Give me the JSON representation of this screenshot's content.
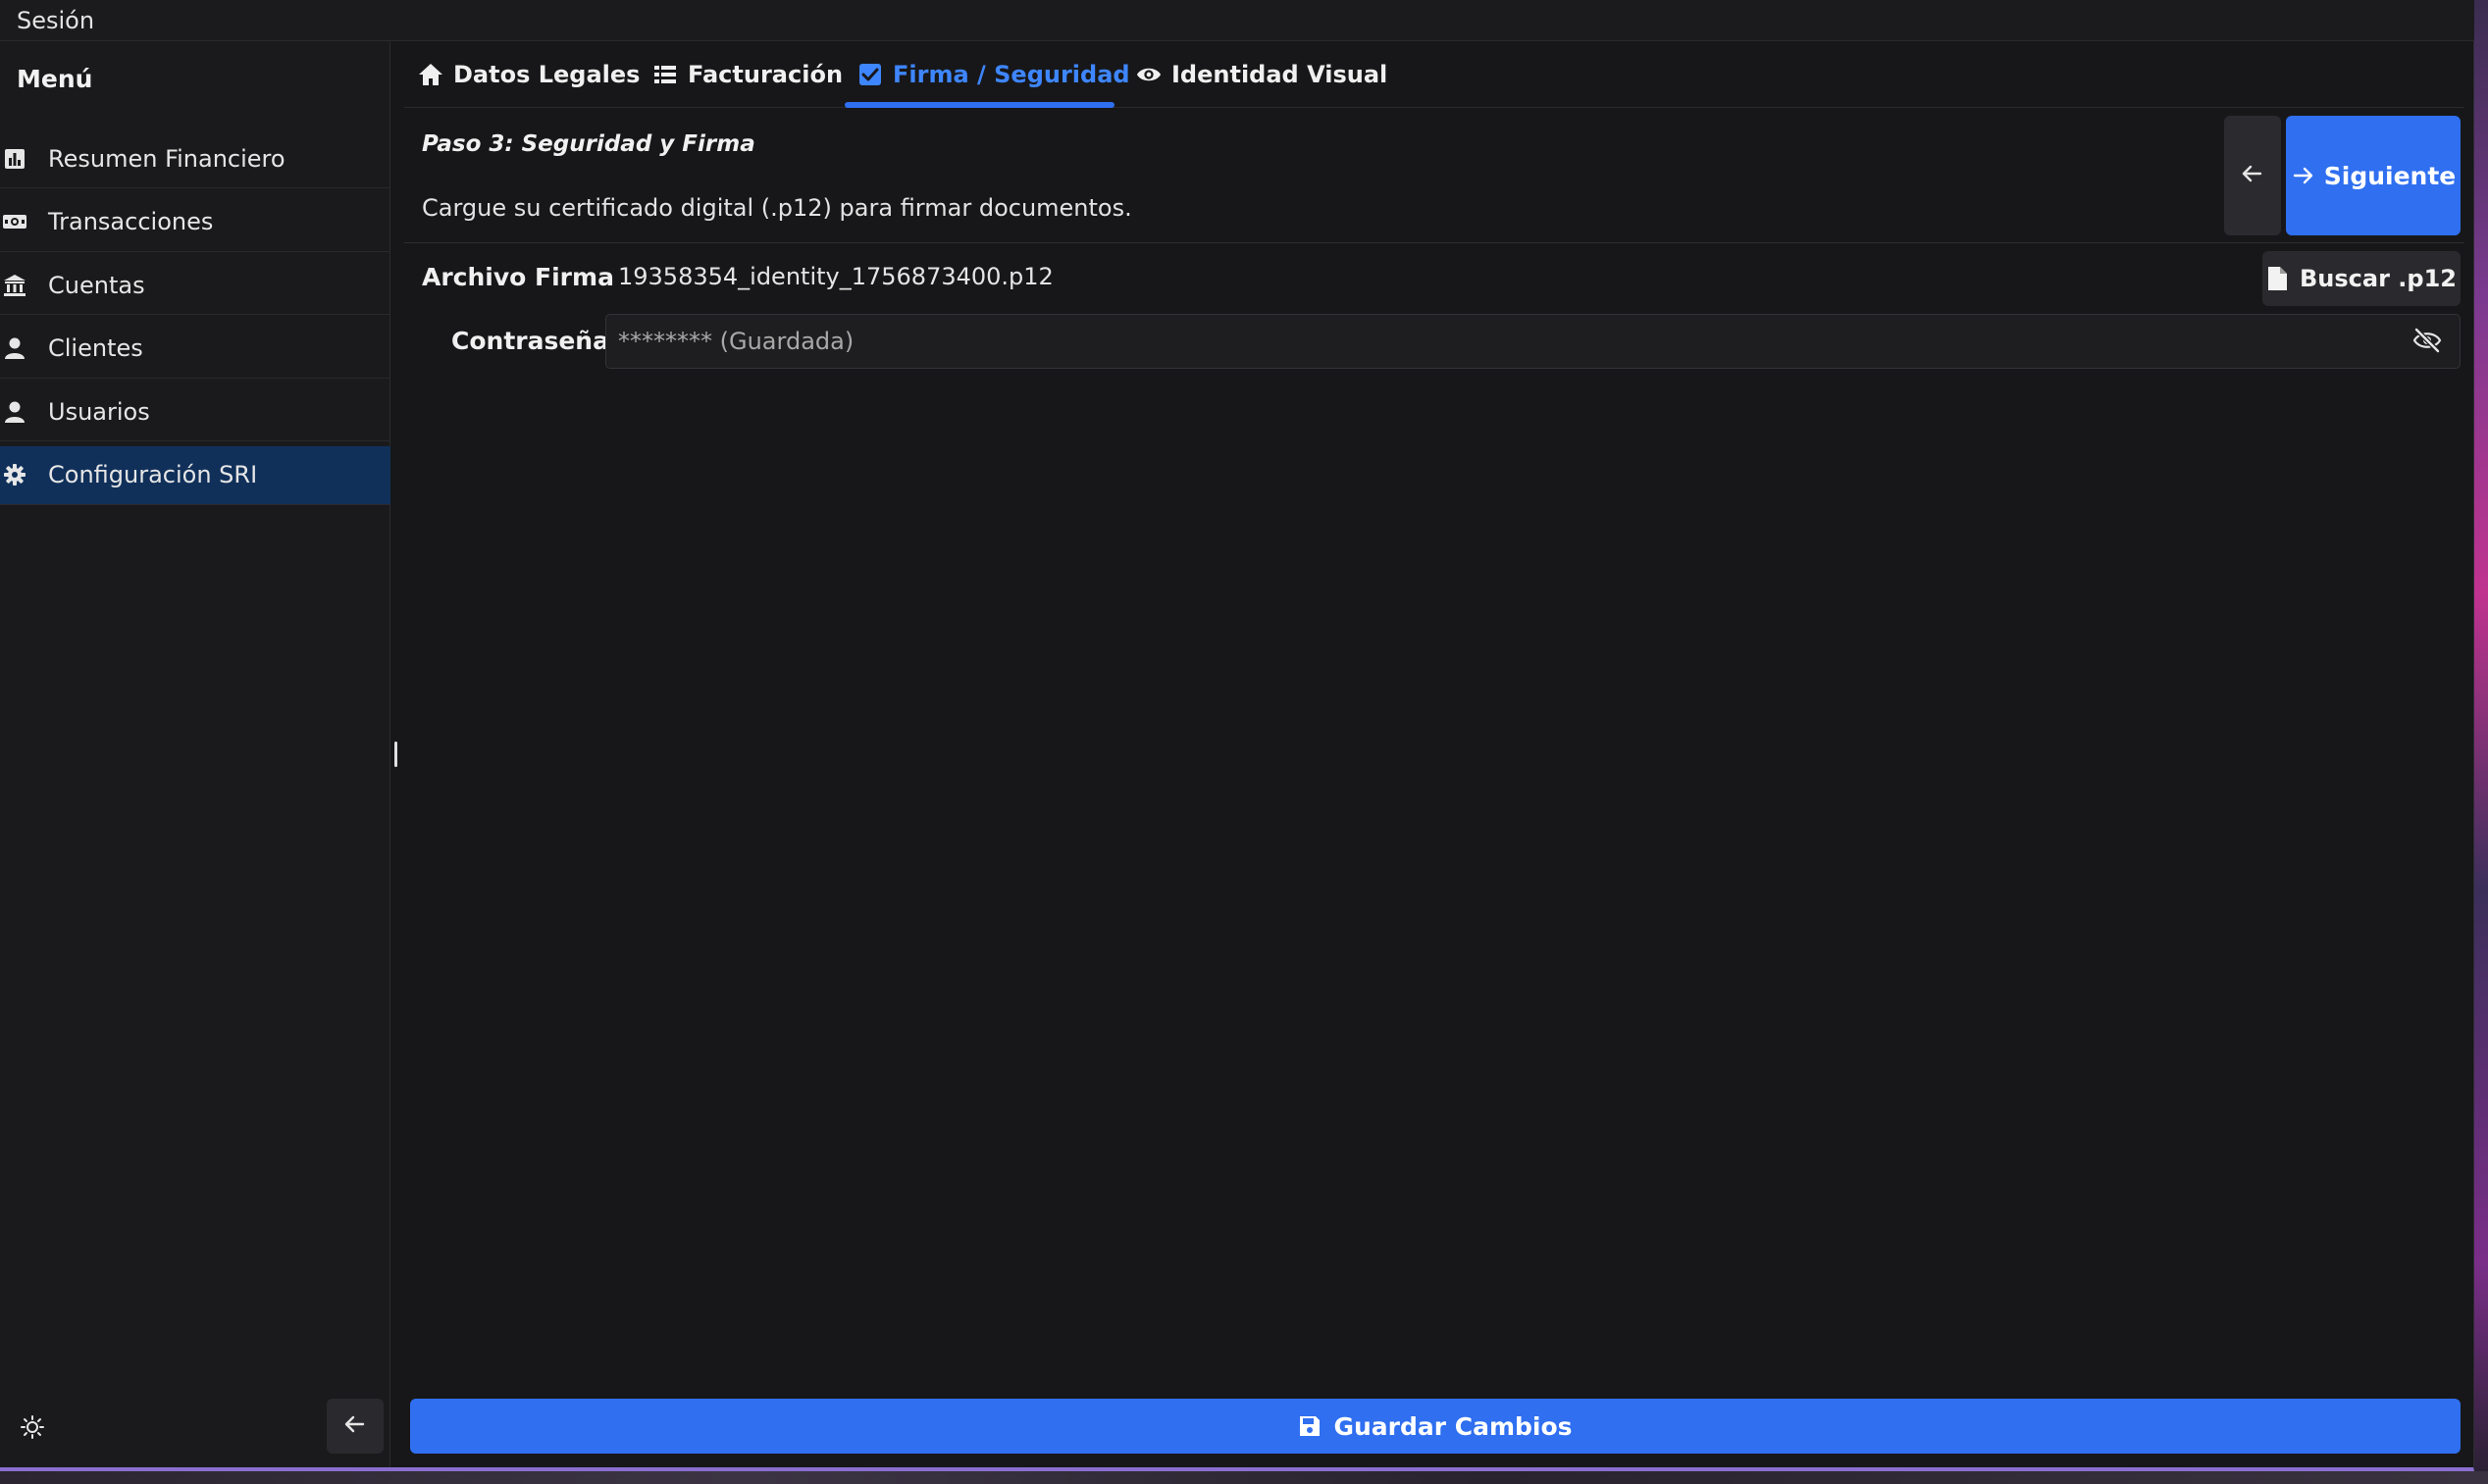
{
  "titlebar": {
    "title": "Sesión"
  },
  "sidebar": {
    "title": "Menú",
    "items": [
      {
        "label": "Resumen Financiero",
        "icon": "bar-chart-icon",
        "active": false
      },
      {
        "label": "Transacciones",
        "icon": "money-bill-icon",
        "active": false
      },
      {
        "label": "Cuentas",
        "icon": "bank-icon",
        "active": false
      },
      {
        "label": "Clientes",
        "icon": "user-icon",
        "active": false
      },
      {
        "label": "Usuarios",
        "icon": "user-icon",
        "active": false
      },
      {
        "label": "Configuración SRI",
        "icon": "gear-icon",
        "active": true
      }
    ],
    "theme_icon": "sun-icon",
    "collapse_icon": "arrow-left-icon"
  },
  "tabs": [
    {
      "label": "Datos Legales",
      "icon": "home-icon",
      "active": false
    },
    {
      "label": "Facturación",
      "icon": "list-icon",
      "active": false
    },
    {
      "label": "Firma / Seguridad",
      "icon": "checkbox-icon",
      "active": true
    },
    {
      "label": "Identidad Visual",
      "icon": "eye-icon",
      "active": false
    }
  ],
  "step": {
    "title": "Paso 3: Seguridad y Firma",
    "description": "Cargue su certificado digital (.p12) para firmar documentos.",
    "next_label": "Siguiente"
  },
  "form": {
    "file_label": "Archivo Firma",
    "file_value": "19358354_identity_1756873400.p12",
    "browse_label": "Buscar .p12",
    "password_label": "Contraseña",
    "password_placeholder": "******** (Guardada)"
  },
  "footer": {
    "save_label": "Guardar Cambios"
  },
  "colors": {
    "accent": "#2f6ff0",
    "active_tab": "#3e86ff",
    "active_nav": "#10305a",
    "background": "#171719"
  }
}
